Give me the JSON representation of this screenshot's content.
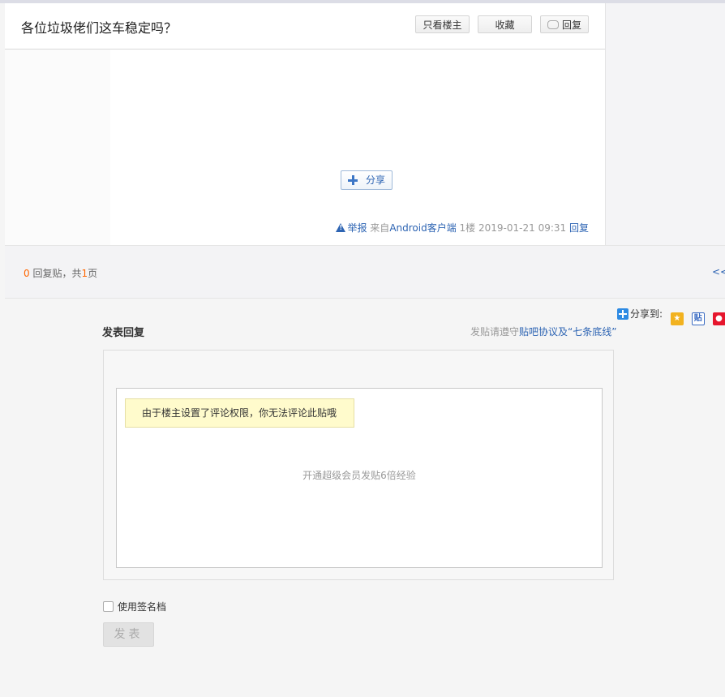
{
  "thread": {
    "title": "各位垃圾佬们这车稳定吗？",
    "buttons": {
      "only_op": "只看楼主",
      "favorite": "收藏",
      "reply": "回复"
    },
    "post": {
      "share_label": "分享",
      "report_label": "举报",
      "source": "来自Android客户端",
      "floor": "1楼",
      "time": "2019-01-21 09:31",
      "reply_label": "回复"
    }
  },
  "pager": {
    "reply_count": "0",
    "reply_suffix": "回复贴，共",
    "page_count": "1",
    "page_suffix": "页",
    "prev_link": "<<"
  },
  "compose": {
    "share_to_label": "分享到:",
    "share_icons": [
      "qzone-icon",
      "tieba-icon",
      "weibo-icon"
    ],
    "tieba_icon_glyph": "贴",
    "title": "发表回复",
    "rules_prefix": "发贴请遵守",
    "rules_link": "贴吧协议及“七条底线”",
    "permission_tip": "由于楼主设置了评论权限，你无法评论此贴哦",
    "vip_promo": "开通超级会员发贴6倍经验",
    "signature_label": "使用签名档",
    "submit_label": "发表"
  },
  "colors": {
    "link": "#2d64b3",
    "count_highlight": "#ff6600",
    "tip_background": "#fffbcc"
  }
}
